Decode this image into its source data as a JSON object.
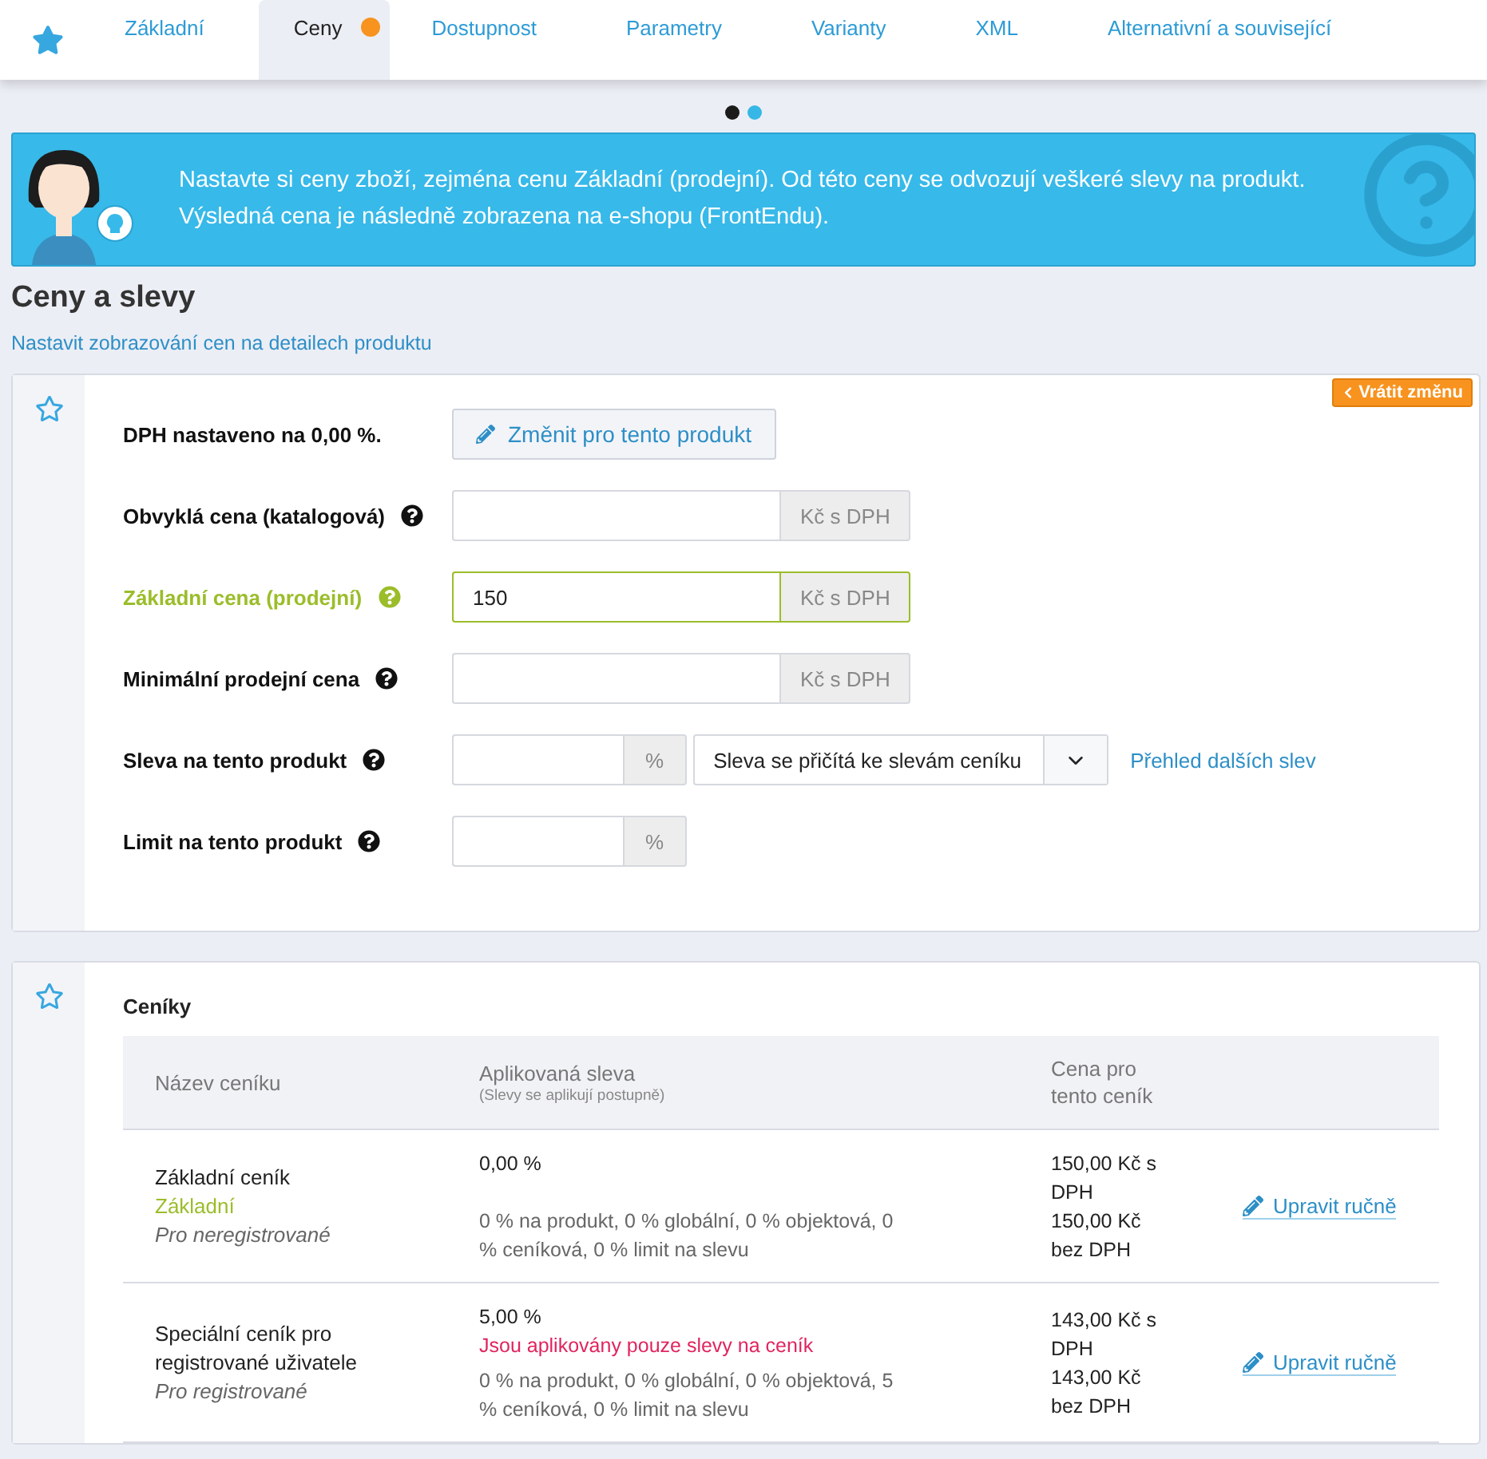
{
  "tabs": [
    {
      "label": "Základní",
      "selected": false,
      "modified": false
    },
    {
      "label": "Ceny",
      "selected": true,
      "modified": true
    },
    {
      "label": "Dostupnost",
      "selected": false,
      "modified": false
    },
    {
      "label": "Parametry",
      "selected": false,
      "modified": false
    },
    {
      "label": "Varianty",
      "selected": false,
      "modified": false
    },
    {
      "label": "XML",
      "selected": false,
      "modified": false
    },
    {
      "label": "Alternativní a související",
      "selected": false,
      "modified": false
    }
  ],
  "pager": [
    {
      "selected": true
    },
    {
      "selected": false
    }
  ],
  "banner": {
    "lines": [
      "Nastavte si ceny zboží, zejména cenu Základní (prodejní). Od této ceny se odvozují veškeré slevy na produkt.",
      "Výsledná cena je následně zobrazena na e-shopu (FrontEndu)."
    ]
  },
  "section": {
    "title": "Ceny a slevy",
    "link": "Nastavit zobrazování cen na detailech produktu"
  },
  "prices_card": {
    "revert_button": "Vrátit změnu",
    "vat": {
      "label": "DPH nastaveno na 0,00 %.",
      "button": "Změnit pro tento produkt"
    },
    "fields": [
      {
        "kind": "price",
        "label": "Obvyklá cena (katalogová)",
        "unit": "Kč s DPH",
        "highlighted": false
      },
      {
        "kind": "price",
        "label": "Základní cena (prodejní)",
        "value": "150",
        "unit": "Kč s DPH",
        "highlighted": true
      },
      {
        "kind": "price",
        "label": "Minimální prodejní cena",
        "unit": "Kč s DPH",
        "highlighted": false
      },
      {
        "kind": "percent_select",
        "label": "Sleva na tento produkt",
        "unit": "%",
        "highlighted": false,
        "select": "Sleva se přičítá ke slevám ceníku",
        "link": "Přehled dalších slev"
      },
      {
        "kind": "percent",
        "label": "Limit na tento produkt",
        "unit": "%",
        "highlighted": false
      }
    ]
  },
  "pricelists_card": {
    "title": "Ceníky",
    "columns": [
      {
        "label": "Název ceníku"
      },
      {
        "label": "Aplikovaná sleva",
        "note": "(Slevy se aplikují postupně)"
      },
      {
        "label": "Cena pro tento ceník"
      }
    ],
    "rows": [
      {
        "name": "Základní ceník",
        "tag": "Základní",
        "audience": "Pro neregistrované",
        "discount": "0,00 %",
        "breakdown": "0 % na produkt, 0 % globální, 0 % objektová, 0 % ceníková, 0 % limit na slevu",
        "price_with_vat": "150,00 Kč s DPH",
        "price_without_vat": "150,00 Kč bez DPH",
        "action": "Upravit ručně"
      },
      {
        "name": "Speciální ceník pro registrované uživatele",
        "audience": "Pro registrované",
        "discount": "5,00 %",
        "warning": "Jsou aplikovány pouze slevy na ceník",
        "breakdown": "0 % na produkt, 0 % globální, 0 % objektová, 5 % ceníková, 0 % limit na slevu",
        "price_with_vat": "143,00 Kč s DPH",
        "price_without_vat": "143,00 Kč bez DPH",
        "action": "Upravit ručně"
      }
    ]
  }
}
